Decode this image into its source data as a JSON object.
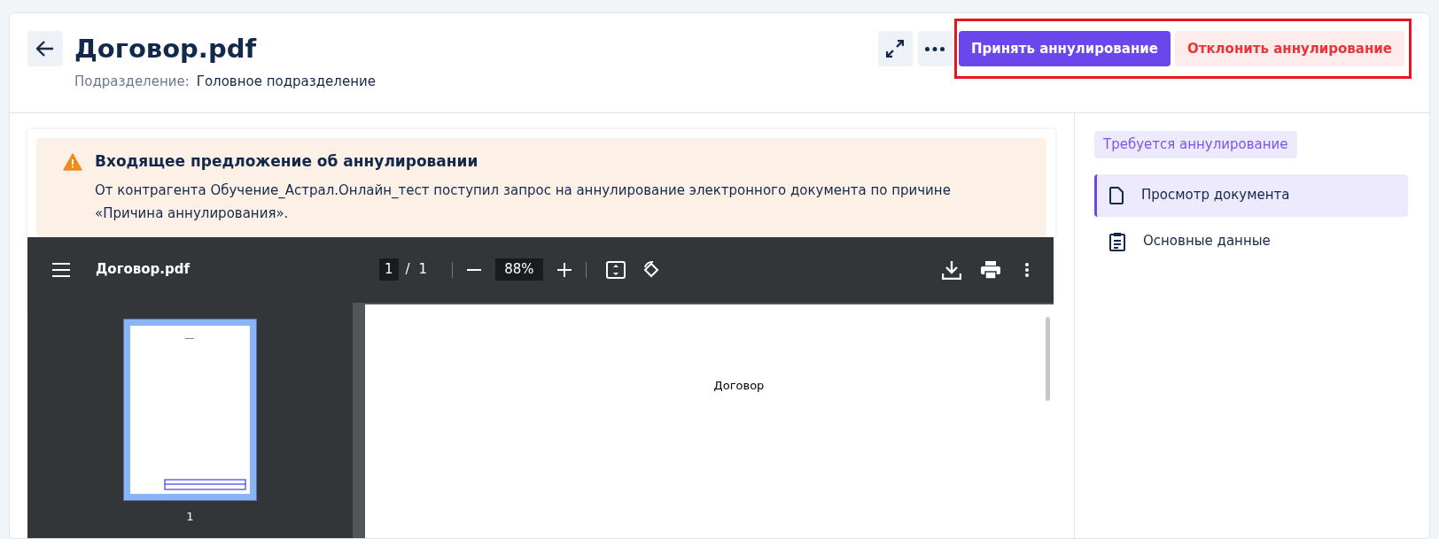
{
  "header": {
    "title": "Договор.pdf",
    "subdivision_label": "Подразделение:",
    "subdivision_value": "Головное подразделение"
  },
  "actions": [
    {
      "kind": "expand"
    },
    {
      "kind": "more"
    },
    {
      "kind": "primary",
      "label": "Принять аннулирование"
    },
    {
      "kind": "danger",
      "label": "Отклонить аннулирование"
    }
  ],
  "alert": {
    "title": "Входящее предложение об аннулировании",
    "message": "От контрагента Обучение_Астрал.Онлайн_тест поступил запрос на аннулирование электронного документа по причине «Причина аннулирования»."
  },
  "viewer": {
    "file_name": "Договор.pdf",
    "page_current": "1",
    "page_separator": "/",
    "page_total": "1",
    "zoom": "88%",
    "page_text": "Договор",
    "thumbnails": [
      {
        "label": "1",
        "selected": true
      }
    ]
  },
  "sidebar": {
    "status_badge": "Требуется аннулирование",
    "items": [
      {
        "label": "Просмотр документа",
        "selected": true
      },
      {
        "label": "Основные данные",
        "selected": false
      }
    ]
  }
}
